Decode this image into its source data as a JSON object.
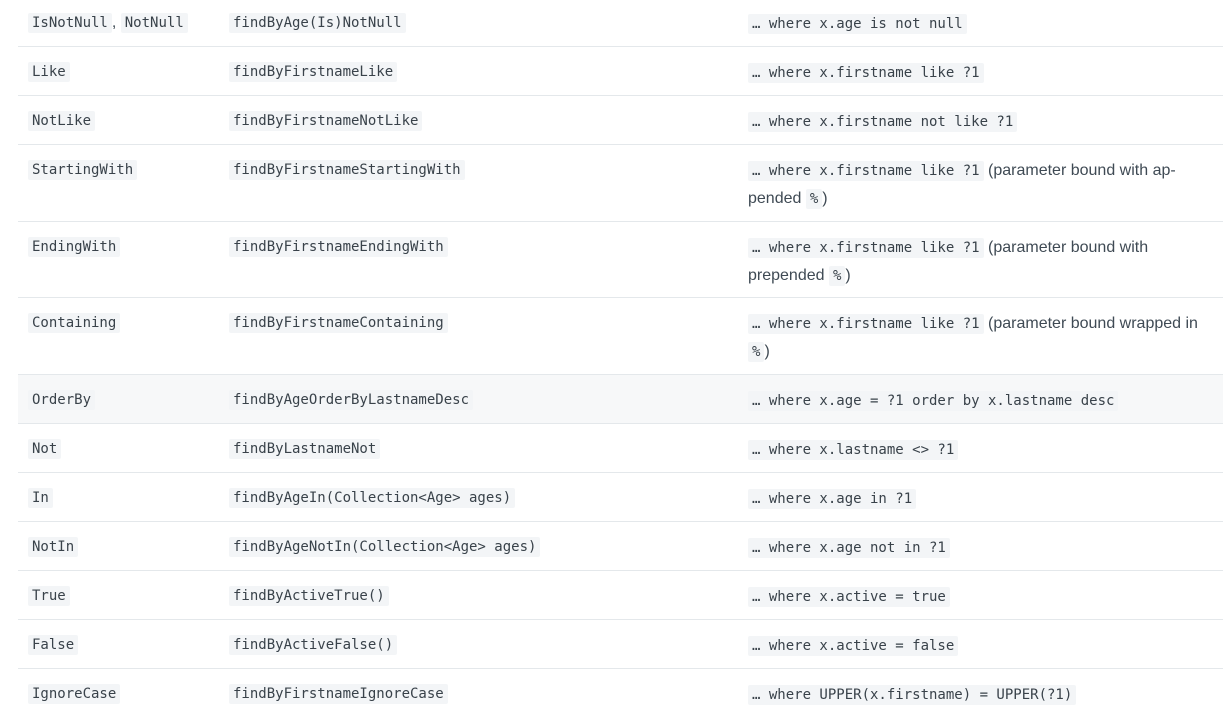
{
  "rows": [
    {
      "keyword": [
        "IsNotNull",
        "NotNull"
      ],
      "sample": "findByAge(Is)NotNull",
      "jpql": "… where x.age is not null",
      "note": ""
    },
    {
      "keyword": [
        "Like"
      ],
      "sample": "findByFirstnameLike",
      "jpql": "… where x.firstname like ?1",
      "note": ""
    },
    {
      "keyword": [
        "NotLike"
      ],
      "sample": "findByFirstnameNotLike",
      "jpql": "… where x.firstname not like ?1",
      "note": ""
    },
    {
      "keyword": [
        "StartingWith"
      ],
      "sample": "findByFirstnameStartingWith",
      "jpql": "… where x.firstname like ?1",
      "note": "(parameter bound with ap-pended",
      "note_code": "%",
      "note_end": ")"
    },
    {
      "keyword": [
        "EndingWith"
      ],
      "sample": "findByFirstnameEndingWith",
      "jpql": "… where x.firstname like ?1",
      "note": "(parameter bound with prepended",
      "note_code": "%",
      "note_end": ")"
    },
    {
      "keyword": [
        "Containing"
      ],
      "sample": "findByFirstnameContaining",
      "jpql": "… where x.firstname like ?1",
      "note": "(parameter bound wrapped in",
      "note_code": "%",
      "note_end": ")"
    },
    {
      "keyword": [
        "OrderBy"
      ],
      "sample": "findByAgeOrderByLastnameDesc",
      "jpql": "… where x.age = ?1 order by x.lastname desc",
      "note": ""
    },
    {
      "keyword": [
        "Not"
      ],
      "sample": "findByLastnameNot",
      "jpql": "… where x.lastname <> ?1",
      "note": ""
    },
    {
      "keyword": [
        "In"
      ],
      "sample": "findByAgeIn(Collection<Age> ages)",
      "jpql": "… where x.age in ?1",
      "note": ""
    },
    {
      "keyword": [
        "NotIn"
      ],
      "sample": "findByAgeNotIn(Collection<Age> ages)",
      "jpql": "… where x.age not in ?1",
      "note": ""
    },
    {
      "keyword": [
        "True"
      ],
      "sample": "findByActiveTrue()",
      "jpql": "… where x.active = true",
      "note": ""
    },
    {
      "keyword": [
        "False"
      ],
      "sample": "findByActiveFalse()",
      "jpql": "… where x.active = false",
      "note": ""
    },
    {
      "keyword": [
        "IgnoreCase"
      ],
      "sample": "findByFirstnameIgnoreCase",
      "jpql": "… where UPPER(x.firstname) = UPPER(?1)",
      "note": ""
    }
  ]
}
